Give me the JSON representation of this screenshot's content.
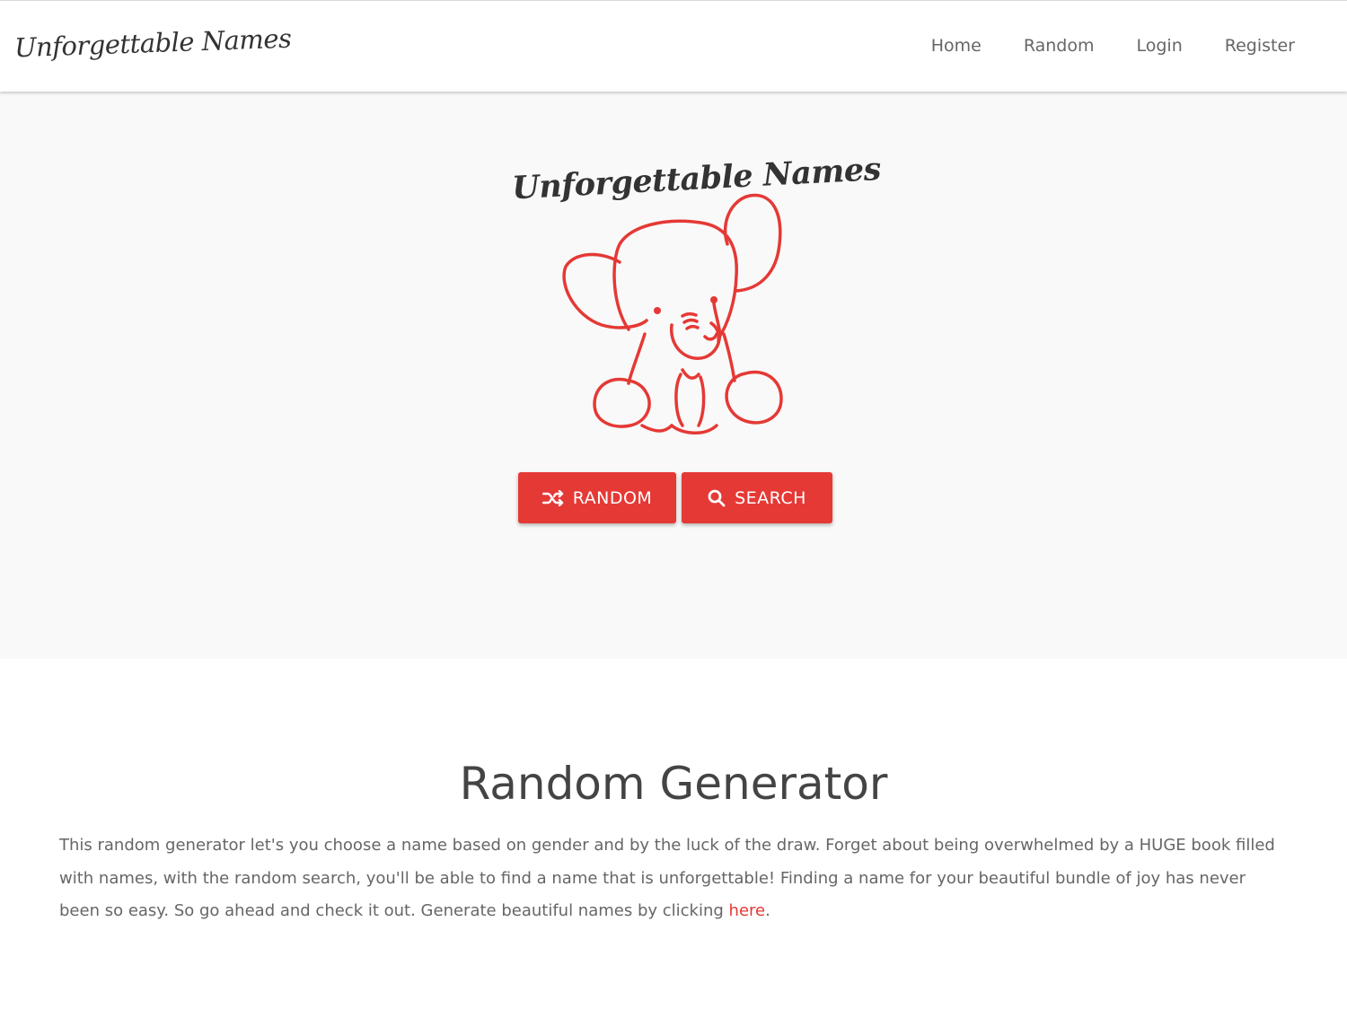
{
  "navbar": {
    "brand": "Unforgettable Names",
    "links": [
      "Home",
      "Random",
      "Login",
      "Register"
    ]
  },
  "hero": {
    "logo_text": "Unforgettable Names",
    "logo_image": "elephant-outline-illustration",
    "buttons": {
      "random_label": "RANDOM",
      "random_icon": "shuffle-icon",
      "search_label": "SEARCH",
      "search_icon": "search-icon"
    }
  },
  "section": {
    "title": "Random Generator",
    "body": "This random generator let's you choose a name based on gender and by the luck of the draw. Forget about being overwhelmed by a HUGE book filled with names, with the random search, you'll be able to find a name that is unforgettable! Finding a name for your beautiful bundle of joy has never been so easy. So go ahead and check it out. Generate beautiful names by clicking ",
    "link_text": "here",
    "trailing": "."
  },
  "colors": {
    "accent": "#e53935",
    "hero_background": "#f9f9f9",
    "text": "#444444"
  }
}
